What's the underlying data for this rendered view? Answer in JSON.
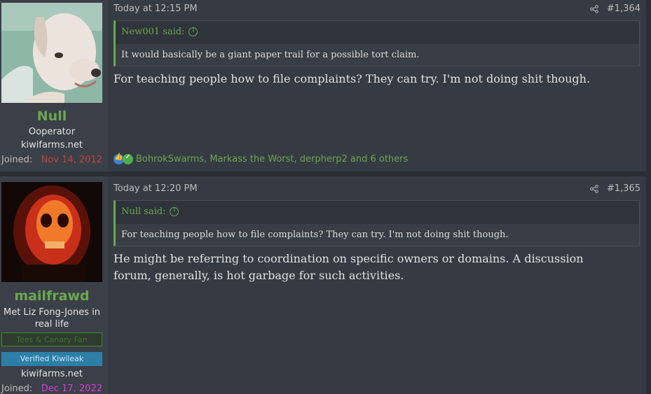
{
  "posts": [
    {
      "username": "Null",
      "user_title": "Ooperator",
      "site": "kiwifarms.net",
      "joined_label": "Joined:",
      "joined_date": "Nov 14, 2012",
      "joined_color": "#c0463e",
      "time": "Today at 12:15 PM",
      "post_number": "#1,364",
      "quote_author": "New001 said:",
      "quote_text": "It would basically be a giant paper trail for a possible tort claim.",
      "message": "For teaching people how to file complaints? They can try. I'm not doing shit though.",
      "reactions_text": "BohrokSwarms, Markass the Worst, derpherp2 and 6 others"
    },
    {
      "username": "mailfrawd",
      "user_title": "Met Liz Fong-Jones in real life",
      "banner_green": "Tees & Canary Fan",
      "banner_blue": "Verified Kiwileak",
      "site": "kiwifarms.net",
      "joined_label": "Joined:",
      "joined_date": "Dec 17, 2022",
      "joined_color": "#d63fd6",
      "time": "Today at 12:20 PM",
      "post_number": "#1,365",
      "quote_author": "Null said:",
      "quote_text": "For teaching people how to file complaints? They can try. I'm not doing shit though.",
      "message": "He might be referring to coordination on specific owners or domains. A discussion forum, generally, is hot garbage for such activities."
    }
  ],
  "icons": {
    "share": "share-icon",
    "quote_up": "arrow-up-circle-icon",
    "like": "like-reaction-icon",
    "agree": "checkmark-reaction-icon"
  },
  "colors": {
    "accent": "#6aa84f",
    "post_bg": "#363a43",
    "page_bg": "#2b2e35"
  }
}
